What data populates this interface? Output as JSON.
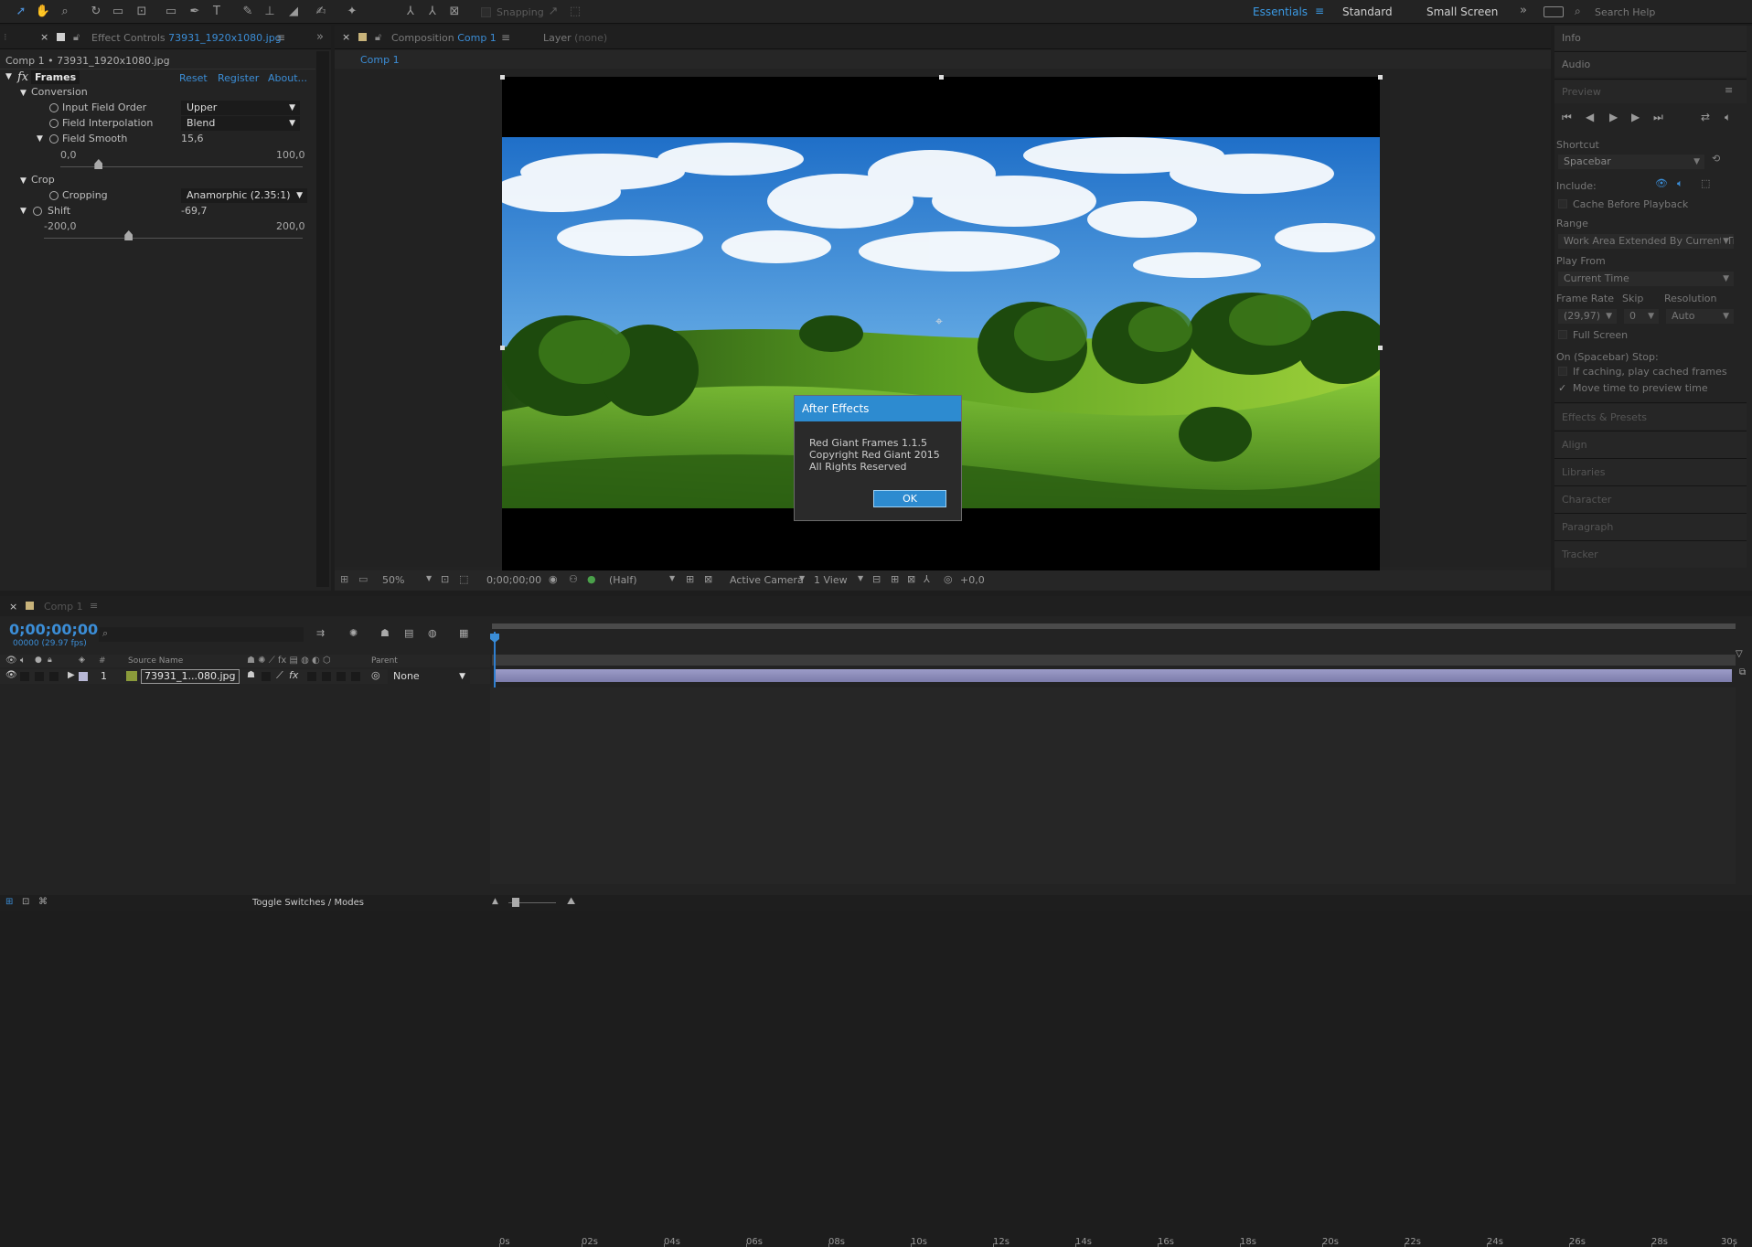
{
  "toolbar": {
    "snapping_label": "Snapping",
    "workspaces": [
      "Essentials",
      "Standard",
      "Small Screen"
    ],
    "active_workspace": "Essentials",
    "search_placeholder": "Search Help"
  },
  "effect_controls": {
    "tab_title": "Effect Controls",
    "tab_file": "73931_1920x1080.jpg",
    "header": "Comp 1 • 73931_1920x1080.jpg",
    "effect_name": "Frames",
    "links": [
      "Reset",
      "Register",
      "About..."
    ],
    "conversion_label": "Conversion",
    "input_field_order_label": "Input Field Order",
    "input_field_order_value": "Upper",
    "field_interpolation_label": "Field Interpolation",
    "field_interpolation_value": "Blend",
    "field_smooth_label": "Field Smooth",
    "field_smooth_value": "15,6",
    "field_smooth_min": "0,0",
    "field_smooth_max": "100,0",
    "field_smooth_fraction": 0.156,
    "crop_label": "Crop",
    "cropping_label": "Cropping",
    "cropping_value": "Anamorphic (2.35:1)",
    "shift_label": "Shift",
    "shift_value": "-69,7",
    "shift_min": "-200,0",
    "shift_max": "200,0",
    "shift_fraction": 0.326
  },
  "composition": {
    "tab_prefix": "Composition",
    "tab_name": "Comp 1",
    "layer_tab": "Layer",
    "layer_tab_value": "(none)",
    "breadcrumb": "Comp 1",
    "zoom": "50%",
    "timecode": "0;00;00;00",
    "resolution": "(Half)",
    "camera": "Active Camera",
    "views": "1 View",
    "exposure": "+0,0"
  },
  "dialog": {
    "title": "After Effects",
    "lines": [
      "Red Giant Frames 1.1.5",
      "Copyright Red Giant 2015",
      "All Rights Reserved"
    ],
    "ok_label": "OK",
    "title_color": "#2d8bd0"
  },
  "right_panel": {
    "info": "Info",
    "audio": "Audio",
    "preview": "Preview",
    "shortcut_label": "Shortcut",
    "shortcut_value": "Spacebar",
    "include_label": "Include:",
    "cache_before_playback": "Cache Before Playback",
    "range_label": "Range",
    "range_value": "Work Area Extended By Current Ti",
    "play_from_label": "Play From",
    "play_from_value": "Current Time",
    "frame_rate_label": "Frame Rate",
    "skip_label": "Skip",
    "resolution_label": "Resolution",
    "frame_rate_value": "(29,97)",
    "skip_value": "0",
    "resolution_value": "Auto",
    "full_screen": "Full Screen",
    "on_stop_label": "On (Spacebar) Stop:",
    "if_caching": "If caching, play cached frames",
    "move_time": "Move time to preview time",
    "collapsed": [
      "Effects & Presets",
      "Align",
      "Libraries",
      "Character",
      "Paragraph",
      "Tracker"
    ]
  },
  "timeline": {
    "tab_name": "Comp 1",
    "timecode": "0;00;00;00",
    "frame_info": "00000 (29.97 fps)",
    "col_number": "#",
    "col_source_name": "Source Name",
    "col_parent": "Parent",
    "layer_number": "1",
    "layer_name": "73931_1...080.jpg",
    "parent_value": "None",
    "toggle_label": "Toggle Switches / Modes",
    "ruler_labels": [
      "0s",
      "02s",
      "04s",
      "06s",
      "08s",
      "10s",
      "12s",
      "14s",
      "16s",
      "18s",
      "20s",
      "22s",
      "24s",
      "26s",
      "28s",
      "30s"
    ]
  }
}
